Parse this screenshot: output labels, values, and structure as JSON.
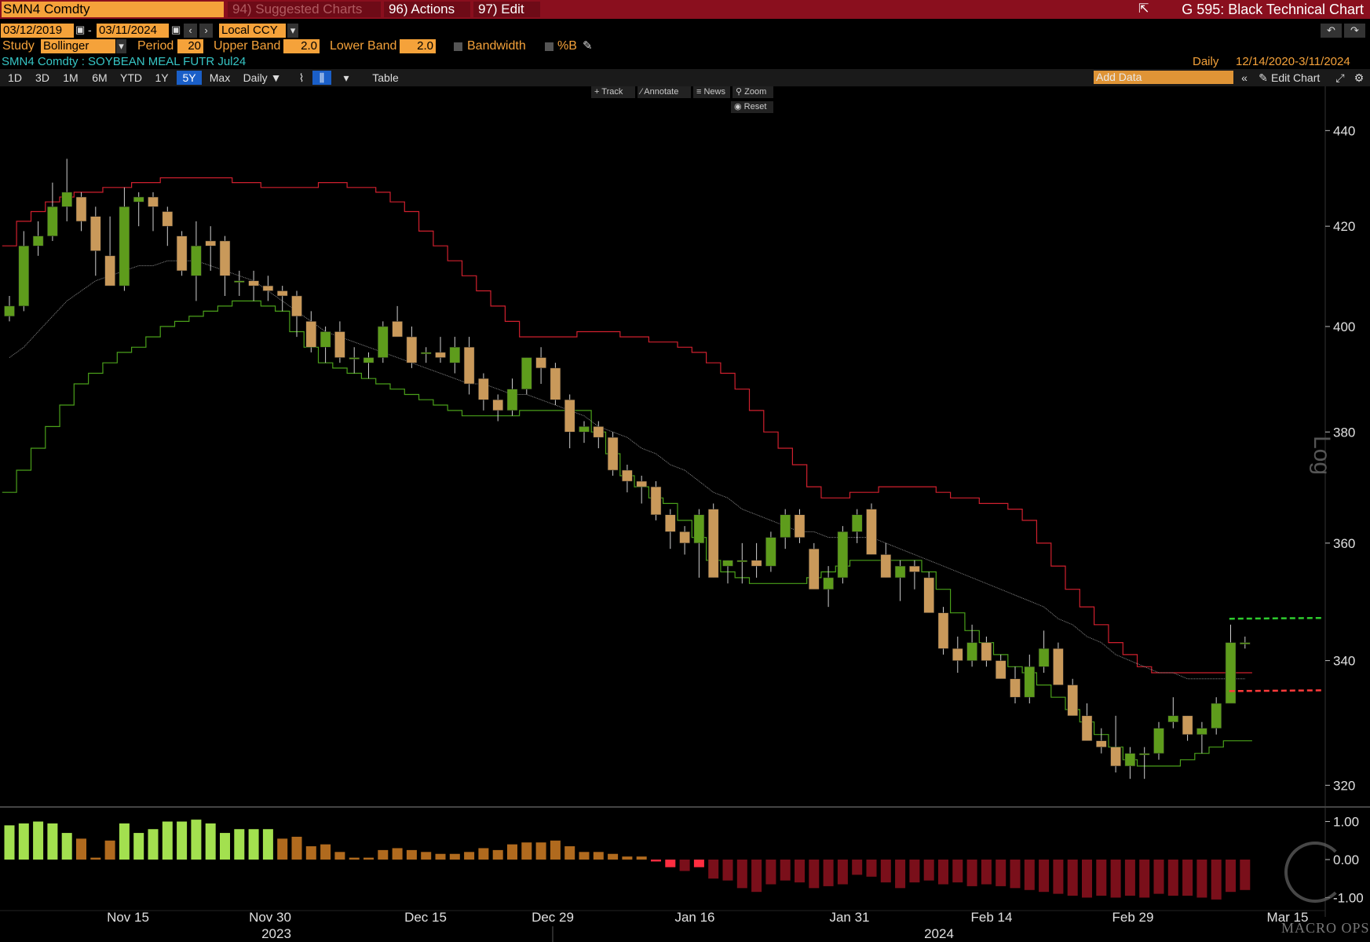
{
  "header": {
    "ticker": "SMN4 Comdty",
    "suggested_charts": "94) Suggested Charts",
    "actions": "96) Actions",
    "edit": "97) Edit",
    "chart_name": "G 595: Black Technical Chart"
  },
  "controls": {
    "start_date": "03/12/2019",
    "end_date": "03/11/2024",
    "currency": "Local CCY",
    "study_label": "Study",
    "study_value": "Bollinger",
    "period_label": "Period",
    "period_value": "20",
    "upper_band_label": "Upper Band",
    "upper_band_value": "2.0",
    "lower_band_label": "Lower Band",
    "lower_band_value": "2.0",
    "bandwidth_label": "Bandwidth",
    "pctb_label": "%B",
    "security_desc": "SMN4 Comdty : SOYBEAN MEAL FUTR Jul24",
    "frequency": "Daily",
    "date_range": "12/14/2020-3/11/2024"
  },
  "toolbar": {
    "ranges": [
      "1D",
      "3D",
      "1M",
      "6M",
      "YTD",
      "1Y",
      "5Y",
      "Max"
    ],
    "active_range": "5Y",
    "period_dropdown": "Daily ▼",
    "table": "Table",
    "add_data_placeholder": "Add Data",
    "edit_chart": "Edit Chart",
    "track": "Track",
    "annotate": "Annotate",
    "news": "News",
    "zoom": "Zoom",
    "reset": "Reset"
  },
  "axis_side_label": "Log",
  "watermark": "MACRO OPS",
  "colors": {
    "background": "#000000",
    "up_candle": "#5e9c1c",
    "down_candle": "#c9995a",
    "upper_band": "#d0202e",
    "lower_band": "#4aa01a",
    "mid_band": "#8a8a8a",
    "hist_pos_bright": "#a3e04f",
    "hist_pos_dim": "#b06a1e",
    "hist_neg_bright": "#ff2d40",
    "hist_neg_dim": "#7a0f1a",
    "orange": "#f5a23a"
  },
  "chart_data": {
    "type": "candlestick",
    "ylim": [
      317,
      447
    ],
    "y_scale": "log",
    "y_ticks": [
      320,
      340,
      360,
      380,
      400,
      420,
      440
    ],
    "x_tick_labels": [
      "Nov 15",
      "Nov 30",
      "Dec 15",
      "Dec 29",
      "Jan 16",
      "Jan 31",
      "Feb 14",
      "Feb 29",
      "Mar 15"
    ],
    "year_labels": [
      "2023",
      "2024"
    ],
    "indicator_ticks": [
      "1.00",
      "0.00",
      "-1.00"
    ],
    "indicator_ylim": [
      -1.3,
      1.3
    ],
    "ohlc": [
      [
        402,
        406,
        401,
        404
      ],
      [
        404,
        419,
        403,
        416
      ],
      [
        416,
        421,
        414,
        418
      ],
      [
        418,
        429,
        417,
        424
      ],
      [
        424,
        434,
        421,
        427
      ],
      [
        426,
        427,
        419,
        421
      ],
      [
        422,
        424,
        410,
        415
      ],
      [
        414,
        422,
        408,
        408
      ],
      [
        408,
        428,
        407,
        424
      ],
      [
        425,
        427,
        420,
        426
      ],
      [
        426,
        427,
        419,
        424
      ],
      [
        423,
        424,
        416,
        420
      ],
      [
        418,
        419,
        410,
        411
      ],
      [
        410,
        421,
        405,
        416
      ],
      [
        417,
        420,
        411,
        416
      ],
      [
        417,
        418,
        406,
        410
      ],
      [
        409,
        411,
        406,
        409
      ],
      [
        409,
        411,
        405,
        408
      ],
      [
        408,
        410,
        405,
        407
      ],
      [
        407,
        408,
        403,
        406
      ],
      [
        406,
        407,
        398,
        402
      ],
      [
        401,
        403,
        395,
        396
      ],
      [
        396,
        400,
        393,
        399
      ],
      [
        399,
        401,
        393,
        394
      ],
      [
        394,
        396,
        391,
        394
      ],
      [
        393,
        395,
        390,
        394
      ],
      [
        394,
        401,
        393,
        400
      ],
      [
        401,
        404,
        398,
        398
      ],
      [
        398,
        400,
        392,
        393
      ],
      [
        395,
        396,
        393,
        395
      ],
      [
        395,
        398,
        393,
        394
      ],
      [
        393,
        398,
        391,
        396
      ],
      [
        396,
        398,
        387,
        389
      ],
      [
        390,
        391,
        384,
        386
      ],
      [
        386,
        387,
        382,
        384
      ],
      [
        384,
        390,
        383,
        388
      ],
      [
        388,
        394,
        387,
        394
      ],
      [
        394,
        396,
        389,
        392
      ],
      [
        392,
        393,
        385,
        386
      ],
      [
        386,
        387,
        377,
        380
      ],
      [
        380,
        382,
        378,
        381
      ],
      [
        381,
        382,
        377,
        379
      ],
      [
        379,
        380,
        372,
        373
      ],
      [
        373,
        374,
        369,
        371
      ],
      [
        371,
        372,
        367,
        370
      ],
      [
        370,
        371,
        364,
        365
      ],
      [
        365,
        366,
        359,
        362
      ],
      [
        362,
        363,
        358,
        360
      ],
      [
        360,
        366,
        354,
        365
      ],
      [
        366,
        367,
        354,
        354
      ],
      [
        356,
        357,
        353,
        357
      ],
      [
        357,
        360,
        353,
        357
      ],
      [
        357,
        360,
        354,
        356
      ],
      [
        356,
        362,
        355,
        361
      ],
      [
        361,
        366,
        359,
        365
      ],
      [
        365,
        366,
        360,
        361
      ],
      [
        359,
        360,
        352,
        352
      ],
      [
        352,
        356,
        349,
        354
      ],
      [
        354,
        363,
        353,
        362
      ],
      [
        362,
        366,
        360,
        365
      ],
      [
        366,
        367,
        358,
        358
      ],
      [
        358,
        360,
        354,
        354
      ],
      [
        354,
        357,
        350,
        356
      ],
      [
        356,
        357,
        352,
        355
      ],
      [
        354,
        355,
        348,
        348
      ],
      [
        348,
        349,
        341,
        342
      ],
      [
        342,
        344,
        338,
        340
      ],
      [
        340,
        346,
        339,
        343
      ],
      [
        343,
        344,
        339,
        340
      ],
      [
        340,
        341,
        337,
        337
      ],
      [
        337,
        339,
        333,
        334
      ],
      [
        334,
        341,
        333,
        339
      ],
      [
        339,
        345,
        338,
        342
      ],
      [
        342,
        343,
        336,
        336
      ],
      [
        336,
        337,
        331,
        331
      ],
      [
        331,
        333,
        327,
        327
      ],
      [
        327,
        329,
        325,
        326
      ],
      [
        326,
        331,
        322,
        323
      ],
      [
        323,
        326,
        321,
        325
      ],
      [
        325,
        326,
        321,
        325
      ],
      [
        325,
        330,
        324,
        329
      ],
      [
        330,
        334,
        329,
        331
      ],
      [
        331,
        331,
        327,
        328
      ],
      [
        328,
        330,
        325,
        329
      ],
      [
        329,
        334,
        328,
        333
      ],
      [
        333,
        346,
        333,
        343
      ],
      [
        343,
        344,
        342,
        343
      ]
    ],
    "upper_band": [
      416,
      421,
      423,
      425,
      426,
      427,
      427,
      428,
      428,
      429,
      429,
      430,
      430,
      430,
      430,
      430,
      429,
      429,
      428,
      428,
      428,
      428,
      429,
      429,
      428,
      428,
      427,
      425,
      423,
      419,
      416,
      413,
      410,
      407,
      404,
      401,
      398,
      398,
      398,
      398,
      399,
      399,
      399,
      398,
      398,
      397,
      397,
      396,
      395,
      393,
      391,
      388,
      384,
      380,
      377,
      374,
      370,
      368,
      368,
      369,
      369,
      370,
      370,
      370,
      370,
      369,
      368,
      368,
      367,
      367,
      366,
      364,
      360,
      356,
      352,
      349,
      346,
      343,
      341,
      339,
      338,
      338,
      338,
      338,
      338,
      338,
      338
    ],
    "lower_band": [
      369,
      373,
      377,
      381,
      385,
      389,
      391,
      393,
      395,
      396,
      398,
      400,
      401,
      402,
      403,
      404,
      405,
      405,
      404,
      403,
      399,
      396,
      393,
      392,
      391,
      390,
      389,
      388,
      387,
      386,
      385,
      384,
      383,
      383,
      383,
      383,
      384,
      384,
      384,
      384,
      384,
      380,
      376,
      372,
      370,
      368,
      367,
      364,
      361,
      357,
      355,
      354,
      353,
      353,
      353,
      353,
      354,
      355,
      356,
      357,
      357,
      357,
      357,
      357,
      355,
      352,
      348,
      345,
      343,
      341,
      339,
      338,
      336,
      334,
      332,
      330,
      328,
      326,
      324,
      323,
      323,
      323,
      324,
      325,
      326,
      327,
      327
    ],
    "mid_band": [
      394,
      396,
      399,
      402,
      405,
      407,
      409,
      410,
      411,
      412,
      412,
      413,
      413,
      413,
      412,
      411,
      410,
      409,
      407,
      405,
      403,
      401,
      399,
      398,
      397,
      396,
      395,
      394,
      393,
      392,
      391,
      390,
      389,
      389,
      388,
      387,
      387,
      386,
      385,
      384,
      383,
      381,
      380,
      379,
      377,
      376,
      374,
      373,
      371,
      369,
      368,
      366,
      365,
      364,
      363,
      362,
      362,
      361,
      361,
      361,
      361,
      360,
      359,
      358,
      357,
      356,
      355,
      354,
      353,
      352,
      351,
      350,
      349,
      347,
      346,
      344,
      343,
      341,
      340,
      339,
      338,
      338,
      337,
      337,
      337,
      337,
      337
    ],
    "indicator": [
      0.9,
      0.95,
      1.0,
      0.95,
      0.7,
      0.55,
      0.05,
      0.5,
      0.95,
      0.7,
      0.8,
      1.0,
      1.0,
      1.05,
      0.95,
      0.7,
      0.8,
      0.8,
      0.8,
      0.55,
      0.6,
      0.35,
      0.4,
      0.2,
      0.05,
      0.05,
      0.25,
      0.3,
      0.25,
      0.2,
      0.15,
      0.15,
      0.2,
      0.3,
      0.25,
      0.4,
      0.45,
      0.45,
      0.5,
      0.35,
      0.2,
      0.2,
      0.15,
      0.08,
      0.08,
      -0.05,
      -0.2,
      -0.3,
      -0.2,
      -0.5,
      -0.55,
      -0.75,
      -0.85,
      -0.65,
      -0.55,
      -0.6,
      -0.75,
      -0.7,
      -0.65,
      -0.4,
      -0.45,
      -0.6,
      -0.75,
      -0.6,
      -0.55,
      -0.65,
      -0.6,
      -0.7,
      -0.65,
      -0.7,
      -0.75,
      -0.8,
      -0.85,
      -0.9,
      -0.95,
      -1.0,
      -0.95,
      -1.0,
      -0.95,
      -1.0,
      -0.9,
      -0.95,
      -0.95,
      -1.0,
      -1.05,
      -0.85,
      -0.8
    ],
    "last_upper_dashed": 347,
    "last_lower_dashed": 335
  }
}
